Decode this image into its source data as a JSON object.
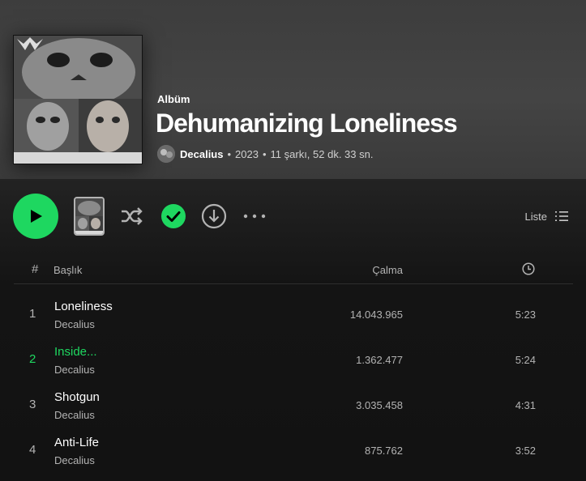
{
  "album": {
    "type_label": "Albüm",
    "title": "Dehumanizing Loneliness",
    "artist": "Decalius",
    "year": "2023",
    "summary": "11 şarkı, 52 dk. 33 sn.",
    "cover_caption": "Dehumanizing Loneliness"
  },
  "controls": {
    "play_icon": "play-icon",
    "shuffle_icon": "shuffle-icon",
    "saved_icon": "check-circle-icon",
    "download_icon": "download-icon",
    "more_icon": "more-icon",
    "view_label": "Liste",
    "view_icon": "list-icon"
  },
  "table": {
    "col_num": "#",
    "col_title": "Başlık",
    "col_plays": "Çalma",
    "col_duration_icon": "clock-icon"
  },
  "tracks": [
    {
      "num": "1",
      "title": "Loneliness",
      "artist": "Decalius",
      "plays": "14.043.965",
      "duration": "5:23"
    },
    {
      "num": "2",
      "title": "Inside...",
      "artist": "Decalius",
      "plays": "1.362.477",
      "duration": "5:24"
    },
    {
      "num": "3",
      "title": "Shotgun",
      "artist": "Decalius",
      "plays": "3.035.458",
      "duration": "4:31"
    },
    {
      "num": "4",
      "title": "Anti-Life",
      "artist": "Decalius",
      "plays": "875.762",
      "duration": "3:52"
    }
  ],
  "active_track_index": 1,
  "colors": {
    "accent": "#1ed760",
    "background": "#121212",
    "header_bg": "#424242",
    "text_primary": "#ffffff",
    "text_secondary": "#b3b3b3"
  }
}
